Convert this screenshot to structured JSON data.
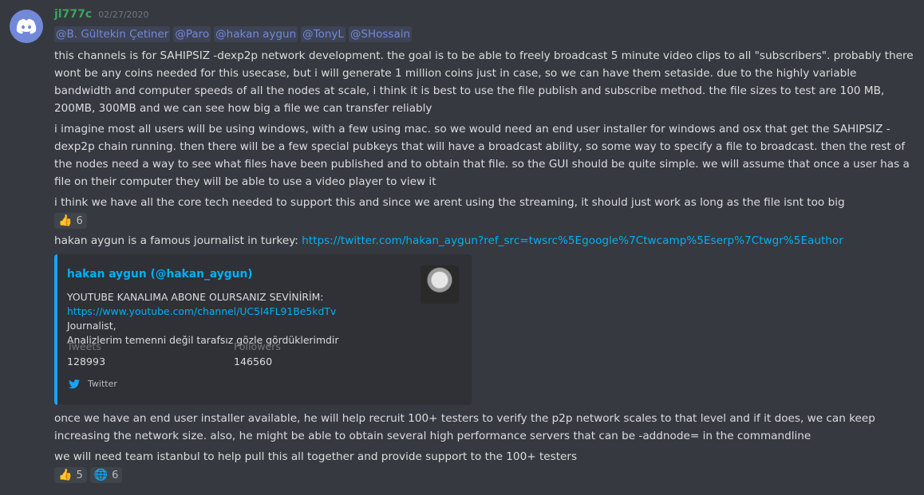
{
  "message": {
    "author": "jl777c",
    "timestamp": "02/27/2020",
    "mentions": [
      "@B. Gültekin Çetiner",
      "@Paro",
      "@hakan aygun",
      "@TonyL",
      "@SHossain"
    ],
    "paragraphs": {
      "p1": "this channels is for SAHIPSIZ -dexp2p network development. the goal is to be able to freely broadcast 5 minute video clips to all \"subscribers\". probably there wont be any coins needed for this usecase, but i will generate 1 million coins just in case, so we can have them setaside. due to the highly variable bandwidth and computer speeds of all the nodes at scale, i think it is best to use the file publish and subscribe method. the file sizes to test are 100 MB, 200MB, 300MB and we can see how big a file we can transfer reliably",
      "p2": "i imagine most all users will be using windows, with a few using mac. so we would need an end user installer for windows and osx that get the SAHIPSIZ -dexp2p chain running. then there will be a few special pubkeys that will have a broadcast ability, so some way to specify a file to broadcast. then the rest of the nodes need a way to see what files have been published and to obtain that file. so the GUI should be quite simple. we will assume that once a user has a file on their computer they will be able to use a video player to view it",
      "p3": "i think we have all the core tech needed to support this and since we arent using the streaming, it should just work as long as the file isnt too big",
      "p4_text": "hakan aygun is a famous journalist in turkey: ",
      "p4_link": "https://twitter.com/hakan_aygun?ref_src=twsrc%5Egoogle%7Ctwcamp%5Eserp%7Ctwgr%5Eauthor",
      "p5": "once we have an end user installer available, he will help recruit 100+ testers to verify the p2p network scales to that level and if it does, we can keep increasing the network size. also, he might be able to obtain several high performance servers that can be -addnode= in the commandline",
      "p6": "we will need team istanbul to help pull this all together and provide support to the 100+ testers"
    },
    "reactions1": [
      {
        "emoji": "👍",
        "count": "6"
      }
    ],
    "reactions2": [
      {
        "emoji": "👍",
        "count": "5"
      },
      {
        "emoji": "🌐",
        "count": "6"
      }
    ],
    "embed": {
      "author": "hakan aygun (@hakan_aygun)",
      "desc_line1": "YOUTUBE KANALIMA ABONE OLURSANIZ SEVİNİRİM:",
      "desc_link": "https://www.youtube.com/channel/UC5I4FL91Be5kdTv",
      "desc_after_link": " Journalist,",
      "desc_line3": "Analizlerim temenni değil tarafsız gözle gördüklerimdir",
      "field1_name": "Tweets",
      "field1_value": "128993",
      "field2_name": "Followers",
      "field2_value": "146560",
      "footer": "Twitter"
    },
    "colors": {
      "background": "#36393f",
      "username": "#3ba55d",
      "link": "#00b0f4",
      "mention": "#7289da",
      "embed_bar": "#1da1f2"
    }
  }
}
